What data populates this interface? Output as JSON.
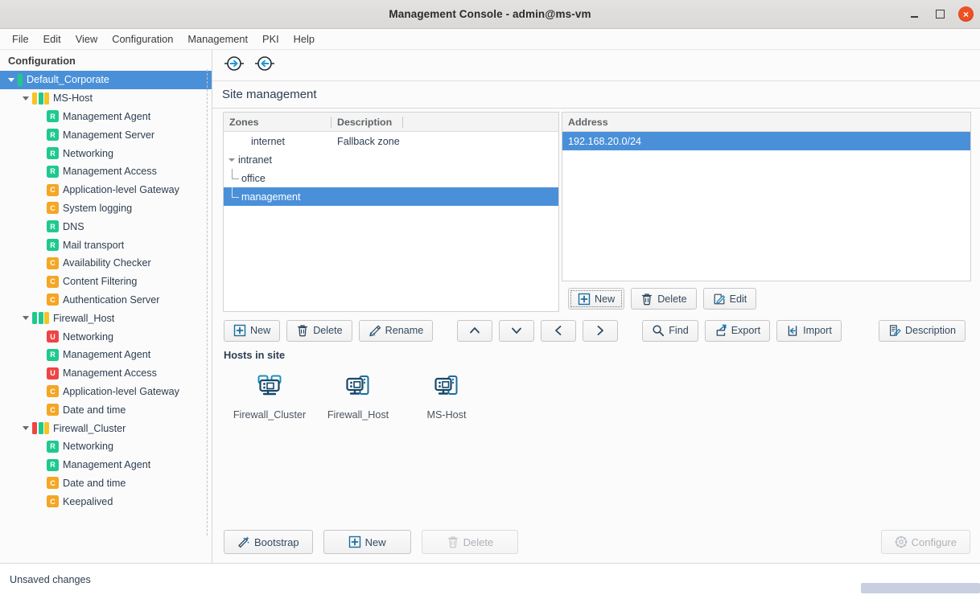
{
  "window": {
    "title": "Management Console - admin@ms-vm",
    "minimize_label": "Minimize",
    "maximize_label": "Maximize",
    "close_label": "×"
  },
  "menubar": {
    "items": [
      {
        "label": "File"
      },
      {
        "label": "Edit"
      },
      {
        "label": "View"
      },
      {
        "label": "Configuration"
      },
      {
        "label": "Management"
      },
      {
        "label": "PKI"
      },
      {
        "label": "Help"
      }
    ]
  },
  "sidebar": {
    "header": "Configuration",
    "tree": [
      {
        "label": "Default_Corporate",
        "depth": 0,
        "twisty": true,
        "selected": true,
        "bars": [
          "#1fc98e"
        ],
        "badge": null
      },
      {
        "label": "MS-Host",
        "depth": 1,
        "twisty": true,
        "selected": false,
        "bars": [
          "#f7c325",
          "#1fc98e",
          "#f7c325"
        ],
        "badge": null
      },
      {
        "label": "Management Agent",
        "depth": 2,
        "twisty": false,
        "selected": false,
        "bars": null,
        "badge": {
          "text": "R",
          "color": "#1fc98e"
        }
      },
      {
        "label": "Management Server",
        "depth": 2,
        "twisty": false,
        "selected": false,
        "bars": null,
        "badge": {
          "text": "R",
          "color": "#1fc98e"
        }
      },
      {
        "label": "Networking",
        "depth": 2,
        "twisty": false,
        "selected": false,
        "bars": null,
        "badge": {
          "text": "R",
          "color": "#1fc98e"
        }
      },
      {
        "label": "Management Access",
        "depth": 2,
        "twisty": false,
        "selected": false,
        "bars": null,
        "badge": {
          "text": "R",
          "color": "#1fc98e"
        }
      },
      {
        "label": "Application-level Gateway",
        "depth": 2,
        "twisty": false,
        "selected": false,
        "bars": null,
        "badge": {
          "text": "C",
          "color": "#f5a623"
        }
      },
      {
        "label": "System logging",
        "depth": 2,
        "twisty": false,
        "selected": false,
        "bars": null,
        "badge": {
          "text": "C",
          "color": "#f5a623"
        }
      },
      {
        "label": "DNS",
        "depth": 2,
        "twisty": false,
        "selected": false,
        "bars": null,
        "badge": {
          "text": "R",
          "color": "#1fc98e"
        }
      },
      {
        "label": "Mail transport",
        "depth": 2,
        "twisty": false,
        "selected": false,
        "bars": null,
        "badge": {
          "text": "R",
          "color": "#1fc98e"
        }
      },
      {
        "label": "Availability Checker",
        "depth": 2,
        "twisty": false,
        "selected": false,
        "bars": null,
        "badge": {
          "text": "C",
          "color": "#f5a623"
        }
      },
      {
        "label": "Content Filtering",
        "depth": 2,
        "twisty": false,
        "selected": false,
        "bars": null,
        "badge": {
          "text": "C",
          "color": "#f5a623"
        }
      },
      {
        "label": "Authentication Server",
        "depth": 2,
        "twisty": false,
        "selected": false,
        "bars": null,
        "badge": {
          "text": "C",
          "color": "#f5a623"
        }
      },
      {
        "label": "Firewall_Host",
        "depth": 1,
        "twisty": true,
        "selected": false,
        "bars": [
          "#1fc98e",
          "#1fc98e",
          "#f7c325"
        ],
        "badge": null
      },
      {
        "label": "Networking",
        "depth": 2,
        "twisty": false,
        "selected": false,
        "bars": null,
        "badge": {
          "text": "U",
          "color": "#ef4444"
        }
      },
      {
        "label": "Management Agent",
        "depth": 2,
        "twisty": false,
        "selected": false,
        "bars": null,
        "badge": {
          "text": "R",
          "color": "#1fc98e"
        }
      },
      {
        "label": "Management Access",
        "depth": 2,
        "twisty": false,
        "selected": false,
        "bars": null,
        "badge": {
          "text": "U",
          "color": "#ef4444"
        }
      },
      {
        "label": "Application-level Gateway",
        "depth": 2,
        "twisty": false,
        "selected": false,
        "bars": null,
        "badge": {
          "text": "C",
          "color": "#f5a623"
        }
      },
      {
        "label": "Date and time",
        "depth": 2,
        "twisty": false,
        "selected": false,
        "bars": null,
        "badge": {
          "text": "C",
          "color": "#f5a623"
        }
      },
      {
        "label": "Firewall_Cluster",
        "depth": 1,
        "twisty": true,
        "selected": false,
        "bars": [
          "#ef4444",
          "#1fc98e",
          "#f7c325"
        ],
        "badge": null
      },
      {
        "label": "Networking",
        "depth": 2,
        "twisty": false,
        "selected": false,
        "bars": null,
        "badge": {
          "text": "R",
          "color": "#1fc98e"
        }
      },
      {
        "label": "Management Agent",
        "depth": 2,
        "twisty": false,
        "selected": false,
        "bars": null,
        "badge": {
          "text": "R",
          "color": "#1fc98e"
        }
      },
      {
        "label": "Date and time",
        "depth": 2,
        "twisty": false,
        "selected": false,
        "bars": null,
        "badge": {
          "text": "C",
          "color": "#f5a623"
        }
      },
      {
        "label": "Keepalived",
        "depth": 2,
        "twisty": false,
        "selected": false,
        "bars": null,
        "badge": {
          "text": "C",
          "color": "#f5a623"
        }
      }
    ]
  },
  "toolbar": {
    "forward_label": "Forward",
    "back_label": "Back"
  },
  "page": {
    "title": "Site management"
  },
  "zones": {
    "columns": [
      "Zones",
      "Description"
    ],
    "rows": [
      {
        "name": "internet",
        "description": "Fallback zone",
        "depth": 1,
        "twisty": false,
        "elbow": false,
        "selected": false
      },
      {
        "name": "intranet",
        "description": "",
        "depth": 0,
        "twisty": true,
        "elbow": false,
        "selected": false
      },
      {
        "name": "office",
        "description": "",
        "depth": 1,
        "twisty": false,
        "elbow": true,
        "selected": false
      },
      {
        "name": "management",
        "description": "",
        "depth": 1,
        "twisty": false,
        "elbow": true,
        "selected": true
      }
    ]
  },
  "address": {
    "column": "Address",
    "rows": [
      {
        "value": "192.168.20.0/24",
        "selected": true
      }
    ],
    "buttons": [
      {
        "label": "New",
        "icon": "plus-box-icon",
        "disabled": false,
        "focused": true
      },
      {
        "label": "Delete",
        "icon": "trash-icon",
        "disabled": false,
        "focused": false
      },
      {
        "label": "Edit",
        "icon": "pencil-square-icon",
        "disabled": false,
        "focused": false
      }
    ]
  },
  "zone_buttons": {
    "left": [
      {
        "label": "New",
        "icon": "plus-box-icon",
        "disabled": false
      },
      {
        "label": "Delete",
        "icon": "trash-icon",
        "disabled": false
      },
      {
        "label": "Rename",
        "icon": "rename-icon",
        "disabled": false
      }
    ],
    "nav": [
      {
        "label": "",
        "icon": "chevron-up-icon",
        "disabled": false
      },
      {
        "label": "",
        "icon": "chevron-down-icon",
        "disabled": false
      },
      {
        "label": "",
        "icon": "chevron-left-icon",
        "disabled": false
      },
      {
        "label": "",
        "icon": "chevron-right-icon",
        "disabled": false
      }
    ],
    "tools": [
      {
        "label": "Find",
        "icon": "magnifier-icon",
        "disabled": false
      },
      {
        "label": "Export",
        "icon": "export-icon",
        "disabled": false
      },
      {
        "label": "Import",
        "icon": "import-icon",
        "disabled": false
      }
    ],
    "right": [
      {
        "label": "Description",
        "icon": "description-icon",
        "disabled": false
      }
    ]
  },
  "hosts": {
    "title": "Hosts in site",
    "items": [
      {
        "label": "Firewall_Cluster",
        "icon": "cluster-icon"
      },
      {
        "label": "Firewall_Host",
        "icon": "host-icon"
      },
      {
        "label": "MS-Host",
        "icon": "host-icon"
      }
    ],
    "buttons": [
      {
        "label": "Bootstrap",
        "icon": "magic-wand-icon",
        "disabled": false
      },
      {
        "label": "New",
        "icon": "plus-box-icon",
        "disabled": false
      },
      {
        "label": "Delete",
        "icon": "trash-icon",
        "disabled": true
      }
    ],
    "right_button": {
      "label": "Configure",
      "icon": "gear-icon",
      "disabled": true
    }
  },
  "statusbar": {
    "message": "Unsaved changes"
  },
  "colors": {
    "accent": "#4a90d9",
    "ok": "#1fc98e",
    "warn": "#f5a623",
    "error": "#ef4444",
    "close": "#ef5023"
  }
}
